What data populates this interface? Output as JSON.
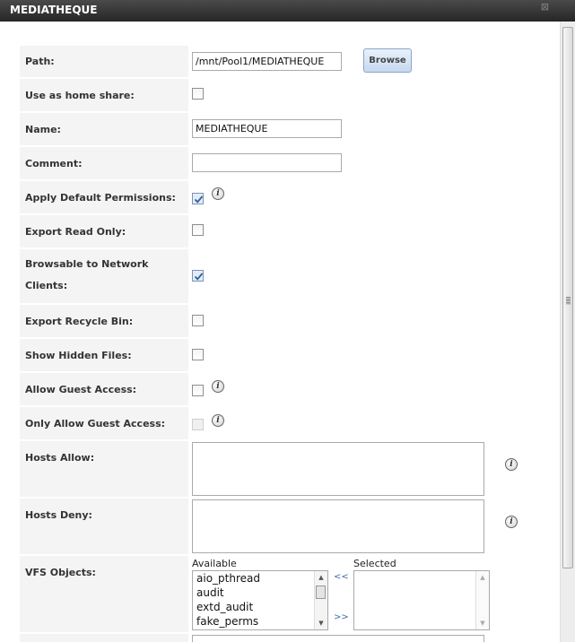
{
  "dialog": {
    "title": "MEDIATHEQUE",
    "close_glyph": "⊠"
  },
  "form": {
    "path": {
      "label": "Path:",
      "value": "/mnt/Pool1/MEDIATHEQUE",
      "browse_label": "Browse"
    },
    "home_share": {
      "label": "Use as home share:",
      "checked": false
    },
    "name": {
      "label": "Name:",
      "value": "MEDIATHEQUE"
    },
    "comment": {
      "label": "Comment:",
      "value": ""
    },
    "default_permissions": {
      "label": "Apply Default Permissions:",
      "checked": true
    },
    "read_only": {
      "label": "Export Read Only:",
      "checked": false
    },
    "browsable": {
      "label": "Browsable to Network Clients:",
      "checked": true
    },
    "recycle_bin": {
      "label": "Export Recycle Bin:",
      "checked": false
    },
    "hidden_files": {
      "label": "Show Hidden Files:",
      "checked": false
    },
    "guest_access": {
      "label": "Allow Guest Access:",
      "checked": false
    },
    "guest_only": {
      "label": "Only Allow Guest Access:",
      "checked": false,
      "disabled": true
    },
    "hosts_allow": {
      "label": "Hosts Allow:",
      "value": ""
    },
    "hosts_deny": {
      "label": "Hosts Deny:",
      "value": ""
    },
    "vfs": {
      "label": "VFS Objects:",
      "available_label": "Available",
      "selected_label": "Selected",
      "available": [
        "aio_pthread",
        "audit",
        "extd_audit",
        "fake_perms"
      ],
      "selected": [],
      "move_left": "<<",
      "move_right": ">>"
    }
  },
  "icons": {
    "info": "info-icon",
    "info_glyph": "i",
    "checkmark": "checkmark-icon",
    "scroll_up": "▲",
    "scroll_down": "▼"
  }
}
